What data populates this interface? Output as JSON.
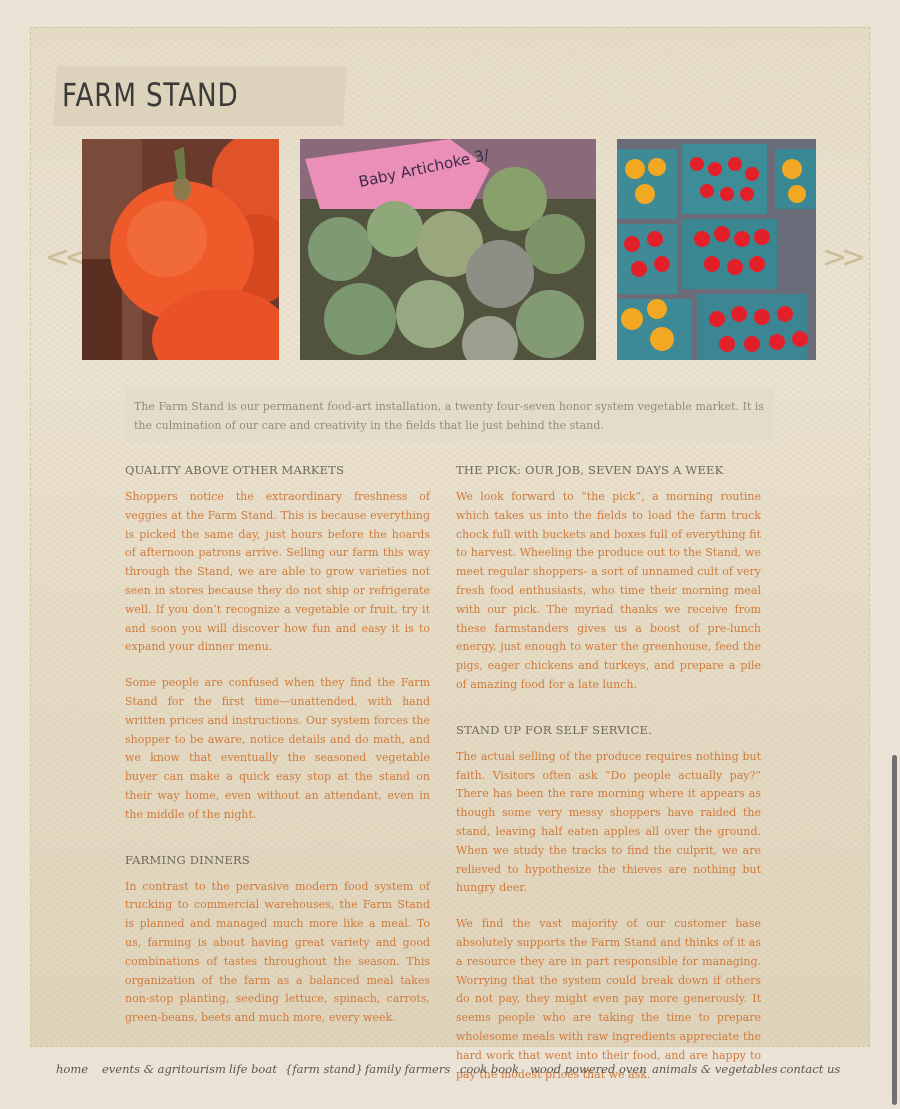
{
  "site": {
    "title": "FARM STAND"
  },
  "carousel": {
    "prev_label": "<<",
    "next_label": ">>",
    "photos": [
      {
        "name": "squash"
      },
      {
        "name": "artichokes",
        "sign_text": "Baby Artichoke 3/"
      },
      {
        "name": "tomatoes"
      }
    ]
  },
  "intro": "The Farm Stand is our permanent food-art installation, a twenty four-seven honor system vegetable market. It is the culmination of our care and creativity in the fields that lie just behind the stand.",
  "left_column": {
    "section1_heading": "QUALITY ABOVE OTHER MARKETS",
    "section1_p1": "Shoppers notice the extraordinary freshness of veggies at the Farm Stand. This is because everything is picked the same day, just hours before the hoards of afternoon patrons arrive. Selling our farm this way through the Stand, we are able to grow varieties not seen in stores because they do not ship or refrigerate well. If you don’t recognize a vegetable or fruit, try it and soon you will discover how fun and easy it is to expand your dinner menu.",
    "section1_p2": "Some people are confused when they find the Farm Stand for the first time—unattended, with hand written prices and instructions. Our system forces the shopper to be aware, notice details and do math, and we know that eventually the seasoned vegetable buyer can make a quick easy stop at the stand on their way home, even without an attendant, even in the middle of the night.",
    "section2_heading": "FARMING DINNERS",
    "section2_p1": "In contrast to the pervasive modern food system of trucking to commercial warehouses, the Farm Stand is planned and managed much more like a meal. To us, farming is about having great variety and good combinations of tastes throughout the season. This organization of the farm as a balanced meal takes non-stop planting, seeding lettuce, spinach, carrots, green-beans, beets and much more, every week."
  },
  "right_column": {
    "section1_heading": "THE PICK: OUR JOB, SEVEN DAYS A WEEK",
    "section1_p1": "We look forward to “the pick”, a morning routine which takes us into the fields to load the farm truck chock full with buckets and boxes full of everything fit to harvest. Wheeling the produce out to the Stand, we meet regular shoppers- a sort of unnamed cult of very fresh food enthusiasts, who time their morning meal with our pick. The myriad thanks we receive from these farmstanders gives us a boost of pre-lunch energy, just enough to water the greenhouse, feed the pigs, eager chickens and turkeys, and prepare a pile of amazing food for a late lunch.",
    "section2_heading": "STAND UP FOR SELF SERVICE.",
    "section2_p1": "The actual selling of the produce requires nothing but faith. Visitors often ask “Do people actually pay?” There has been the rare morning where it appears as though some very messy shoppers have raided the stand, leaving half eaten apples all over the ground. When we study the tracks to find the culprit, we are relieved to hypothesize the thieves are nothing but hungry deer.",
    "section2_p2": "We find the vast majority of our customer base absolutely supports the Farm Stand and thinks of it as a resource they are in part responsible for managing. Worrying that the system could break down if others do not pay, they might even pay more generously. It seems people who are taking the time to prepare wholesome meals with raw ingredients appreciate the hard work that went into their food, and are happy to pay the modest prices that we ask."
  },
  "nav": {
    "home": "home",
    "events": "events & agritourism",
    "life_boat": "life boat",
    "farm_stand": "{farm stand}",
    "family_farmers": "family farmers",
    "cook_book": "cook book",
    "wood_oven": "wood powered oven",
    "animals": "animals & vegetables",
    "contact": "contact us"
  },
  "colors": {
    "background": "#e9e2d5",
    "body_text": "#cf7a3c",
    "heading_text": "#6d6957",
    "nav_text": "#5a564a"
  }
}
